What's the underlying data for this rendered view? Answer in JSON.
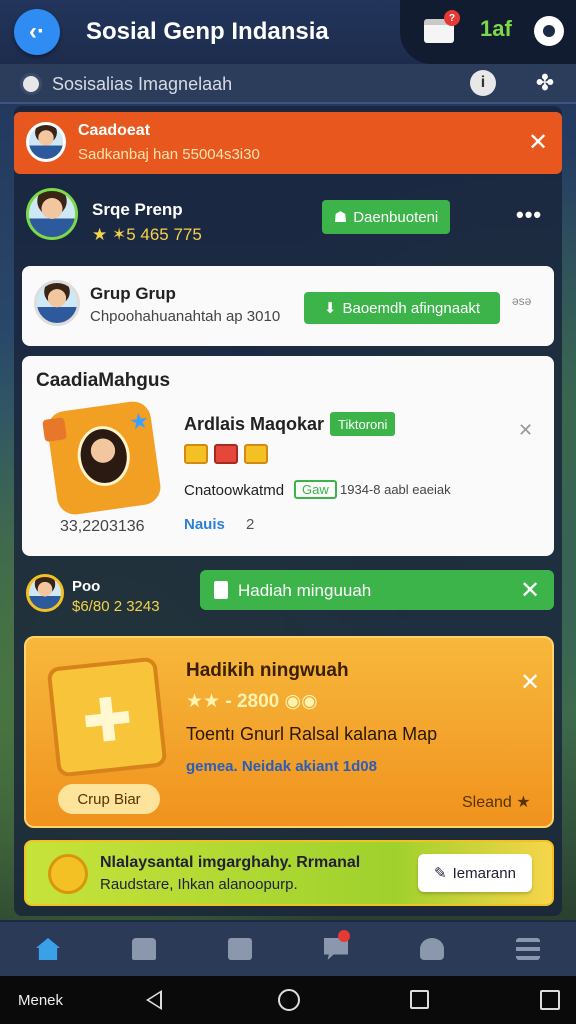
{
  "header": {
    "title": "Sosial Genp Indansia",
    "notification_badge": "?",
    "count": "1af"
  },
  "subheader": {
    "title": "Sosisalias Imagnelaah"
  },
  "card_banner_top": {
    "name": "Caadoeat",
    "subtitle": "Sadkanbaj han 55004s3i30"
  },
  "card_group": {
    "name": "Srqe Prenp",
    "score": "★ ✶5 465 775",
    "button_label": "Daenbuoteni",
    "more": "•••"
  },
  "card_grup": {
    "name": "Grup Grup",
    "subtitle": "Chpoohahuanahtah ap 3010",
    "button_label": "Baoemdh afingnaakt",
    "count": "əsə"
  },
  "card_feature": {
    "title": "CaadiaMahgus",
    "item_name": "Ardlais Maqokar",
    "item_tag": "Tiktoroni",
    "info_label": "Cnatoowkatmd",
    "info_tag": "Gaw",
    "info_value": "1934-8 aabl eaeiak",
    "link": "Nauis",
    "link_number": "2",
    "count": "33,2203136"
  },
  "row_reward": {
    "name": "Poo",
    "subtitle": "$6/80 2 3243",
    "banner_text": "Hadiah minguuah"
  },
  "card_weekly": {
    "title": "Hadikih ningwuah",
    "stars_text": "★★ - 2800 ◉◉",
    "description": "Toentı Gnurl Ralsal kalana Map",
    "link": "gemea. Neidak akiant 1d08",
    "button_label": "Crup Biar",
    "stand_label": "Sleand ★"
  },
  "card_promo": {
    "line1": "Nlalaysantal imgarghahy. Rrmanal",
    "line2": "Raudstare, Ihkan alanoopurp.",
    "button_label": "Iemarann"
  },
  "system_bar": {
    "label": "Menek"
  },
  "colors": {
    "accent_blue": "#2f8cf2",
    "green": "#3cb44a",
    "orange": "#e8581e"
  }
}
